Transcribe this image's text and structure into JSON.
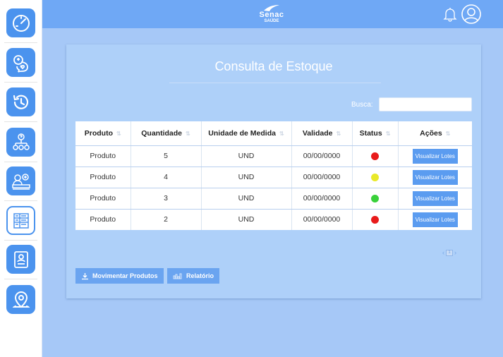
{
  "header": {
    "logo_line1": "Senac",
    "logo_line2": "SAÚDE"
  },
  "sidebar": {
    "items": [
      {
        "icon": "speedometer-icon",
        "active": false
      },
      {
        "icon": "chat-heart-icon",
        "active": false
      },
      {
        "icon": "history-icon",
        "active": false
      },
      {
        "icon": "org-chart-question-icon",
        "active": false
      },
      {
        "icon": "medical-desk-icon",
        "active": false
      },
      {
        "icon": "inventory-grid-icon",
        "active": true
      },
      {
        "icon": "id-badge-icon",
        "active": false
      },
      {
        "icon": "location-pin-icon",
        "active": false
      }
    ]
  },
  "page": {
    "title": "Consulta de Estoque",
    "search_label": "Busca:",
    "search_value": ""
  },
  "table": {
    "columns": [
      "Produto",
      "Quantidade",
      "Unidade de Medida",
      "Validade",
      "Status",
      "Ações"
    ],
    "rows": [
      {
        "produto": "Produto",
        "quantidade": "5",
        "unidade": "UND",
        "validade": "00/00/0000",
        "status_color": "#e81b1b",
        "action": "Visualizar Lotes"
      },
      {
        "produto": "Produto",
        "quantidade": "4",
        "unidade": "UND",
        "validade": "00/00/0000",
        "status_color": "#e9e92a",
        "action": "Visualizar Lotes"
      },
      {
        "produto": "Produto",
        "quantidade": "3",
        "unidade": "UND",
        "validade": "00/00/0000",
        "status_color": "#3ad13a",
        "action": "Visualizar Lotes"
      },
      {
        "produto": "Produto",
        "quantidade": "2",
        "unidade": "UND",
        "validade": "00/00/0000",
        "status_color": "#e81b1b",
        "action": "Visualizar Lotes"
      }
    ]
  },
  "pagination": {
    "current_page": "1"
  },
  "actions": {
    "movimentar": "Movimentar Produtos",
    "relatorio": "Relatório"
  },
  "colors": {
    "accent": "#4b93ee",
    "topbar": "#6fa8f5",
    "background": "#a6c8f7",
    "card": "#aed0f9"
  }
}
